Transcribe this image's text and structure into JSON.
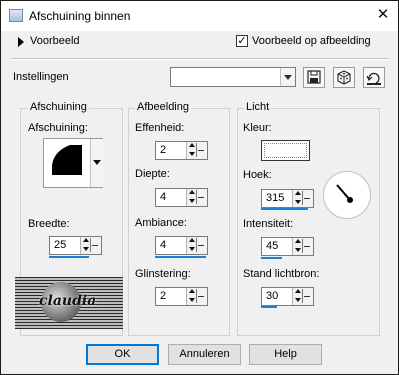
{
  "window": {
    "title": "Afschuining binnen",
    "close_label": "✕"
  },
  "preview": {
    "toggle_label": "Voorbeeld",
    "on_image_label": "Voorbeeld op afbeelding",
    "on_image_checked": true,
    "check_mark": "✓"
  },
  "presets": {
    "label": "Instellingen",
    "value": ""
  },
  "groups": {
    "bevel": {
      "title": "Afschuining",
      "shape_label": "Afschuining:",
      "width_label": "Breedte:",
      "width_value": "25",
      "width_level_pct": 76
    },
    "image": {
      "title": "Afbeelding",
      "smoothness_label": "Effenheid:",
      "smoothness_value": "2",
      "depth_label": "Diepte:",
      "depth_value": "4",
      "ambience_label": "Ambiance:",
      "ambience_value": "4",
      "ambience_level_pct": 96,
      "shininess_label": "Glinstering:",
      "shininess_value": "2"
    },
    "light": {
      "title": "Licht",
      "color_label": "Kleur:",
      "color_value": "#ffffff",
      "angle_label": "Hoek:",
      "angle_value": "315",
      "intensity_label": "Intensiteit:",
      "intensity_value": "45",
      "intensity_level_pct": 40,
      "elevation_label": "Stand lichtbron:",
      "elevation_value": "30",
      "elevation_level_pct": 30
    }
  },
  "watermark": {
    "text": "claudia"
  },
  "buttons": {
    "ok": "OK",
    "cancel": "Annuleren",
    "help": "Help"
  }
}
